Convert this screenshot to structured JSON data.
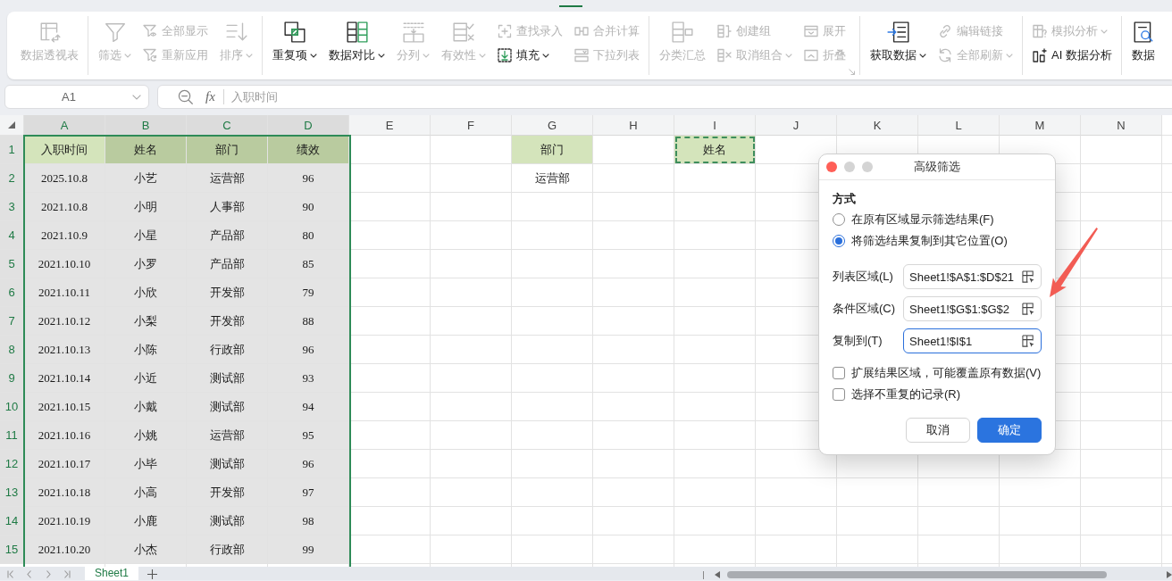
{
  "ribbon": {
    "groups": [
      {
        "launcher": false,
        "columns": [
          {
            "kind": "large",
            "items": [
              {
                "label": "数据透视表",
                "disabled": true,
                "dropdown": false
              }
            ]
          }
        ]
      },
      {
        "launcher": false,
        "columns": [
          {
            "kind": "large",
            "items": [
              {
                "label": "筛选",
                "disabled": true,
                "dropdown": true
              }
            ]
          },
          {
            "kind": "small",
            "items": [
              {
                "label": "全部显示",
                "disabled": true,
                "dropdown": false
              },
              {
                "label": "重新应用",
                "disabled": true,
                "dropdown": false
              }
            ]
          },
          {
            "kind": "large",
            "items": [
              {
                "label": "排序",
                "disabled": true,
                "dropdown": true
              }
            ]
          }
        ]
      },
      {
        "launcher": false,
        "columns": [
          {
            "kind": "large",
            "items": [
              {
                "label": "重复项",
                "disabled": false,
                "dropdown": true
              }
            ]
          },
          {
            "kind": "large",
            "items": [
              {
                "label": "数据对比",
                "disabled": false,
                "dropdown": true
              }
            ]
          },
          {
            "kind": "large",
            "items": [
              {
                "label": "分列",
                "disabled": true,
                "dropdown": true
              }
            ]
          },
          {
            "kind": "large",
            "items": [
              {
                "label": "有效性",
                "disabled": true,
                "dropdown": true
              }
            ]
          },
          {
            "kind": "small",
            "items": [
              {
                "label": "查找录入",
                "disabled": true,
                "dropdown": false
              },
              {
                "label": "填充",
                "disabled": false,
                "dropdown": true
              }
            ]
          },
          {
            "kind": "small",
            "items": [
              {
                "label": "合并计算",
                "disabled": true,
                "dropdown": false
              },
              {
                "label": "下拉列表",
                "disabled": true,
                "dropdown": false
              }
            ]
          }
        ]
      },
      {
        "launcher": true,
        "columns": [
          {
            "kind": "large",
            "items": [
              {
                "label": "分类汇总",
                "disabled": true,
                "dropdown": false
              }
            ]
          },
          {
            "kind": "small",
            "items": [
              {
                "label": "创建组",
                "disabled": true,
                "dropdown": false
              },
              {
                "label": "取消组合",
                "disabled": true,
                "dropdown": true
              }
            ]
          },
          {
            "kind": "small",
            "items": [
              {
                "label": "展开",
                "disabled": true,
                "dropdown": false
              },
              {
                "label": "折叠",
                "disabled": true,
                "dropdown": false
              }
            ]
          }
        ]
      },
      {
        "launcher": false,
        "columns": [
          {
            "kind": "large",
            "items": [
              {
                "label": "获取数据",
                "disabled": false,
                "dropdown": true
              }
            ]
          },
          {
            "kind": "small",
            "items": [
              {
                "label": "编辑链接",
                "disabled": true,
                "dropdown": false
              },
              {
                "label": "全部刷新",
                "disabled": true,
                "dropdown": true
              }
            ]
          }
        ]
      },
      {
        "launcher": false,
        "columns": [
          {
            "kind": "small",
            "items": [
              {
                "label": "模拟分析",
                "disabled": true,
                "dropdown": true
              },
              {
                "label": "AI 数据分析",
                "disabled": false,
                "dropdown": false
              }
            ]
          }
        ]
      },
      {
        "launcher": false,
        "columns": [
          {
            "kind": "large",
            "items": [
              {
                "label": "数据",
                "disabled": false,
                "dropdown": false
              }
            ]
          }
        ]
      }
    ]
  },
  "formula_bar": {
    "name_box": "A1",
    "function_label": "fx",
    "formula": "入职时间"
  },
  "grid": {
    "columns": [
      {
        "label": "A",
        "selected": true
      },
      {
        "label": "B",
        "selected": true
      },
      {
        "label": "C",
        "selected": true
      },
      {
        "label": "D",
        "selected": true
      },
      {
        "label": "E",
        "selected": false
      },
      {
        "label": "F",
        "selected": false
      },
      {
        "label": "G",
        "selected": false
      },
      {
        "label": "H",
        "selected": false
      },
      {
        "label": "I",
        "selected": false
      },
      {
        "label": "J",
        "selected": false
      },
      {
        "label": "K",
        "selected": false
      },
      {
        "label": "L",
        "selected": false
      },
      {
        "label": "M",
        "selected": false
      },
      {
        "label": "N",
        "selected": false
      }
    ],
    "rows": [
      {
        "label": "1",
        "selected": true,
        "cells": [
          {
            "text": "入职时间",
            "highlighted": true,
            "active": true
          },
          {
            "text": "姓名",
            "highlighted": true
          },
          {
            "text": "部门",
            "highlighted": true
          },
          {
            "text": "绩效",
            "highlighted": true
          },
          {
            "highlighted": false
          },
          {
            "highlighted": false
          },
          {
            "text": "部门",
            "highlighted": true
          },
          {
            "highlighted": false
          },
          {
            "text": "姓名",
            "highlighted": true,
            "marquee": true
          }
        ]
      },
      {
        "label": "2",
        "selected": true,
        "cells": [
          {
            "text": "2025.10.8",
            "highlighted": false
          },
          {
            "text": "小艺",
            "highlighted": false
          },
          {
            "text": "运营部",
            "highlighted": false
          },
          {
            "text": "96",
            "highlighted": false
          },
          {
            "highlighted": false
          },
          {
            "highlighted": false
          },
          {
            "text": "运营部",
            "highlighted": false
          }
        ]
      },
      {
        "label": "3",
        "selected": true,
        "cells": [
          {
            "text": "2021.10.8",
            "highlighted": false
          },
          {
            "text": "小明",
            "highlighted": false
          },
          {
            "text": "人事部",
            "highlighted": false
          },
          {
            "text": "90",
            "highlighted": false
          }
        ]
      },
      {
        "label": "4",
        "selected": true,
        "cells": [
          {
            "text": "2021.10.9",
            "highlighted": false
          },
          {
            "text": "小星",
            "highlighted": false
          },
          {
            "text": "产品部",
            "highlighted": false
          },
          {
            "text": "80",
            "highlighted": false
          }
        ]
      },
      {
        "label": "5",
        "selected": true,
        "cells": [
          {
            "text": "2021.10.10",
            "highlighted": false
          },
          {
            "text": "小罗",
            "highlighted": false
          },
          {
            "text": "产品部",
            "highlighted": false
          },
          {
            "text": "85",
            "highlighted": false
          }
        ]
      },
      {
        "label": "6",
        "selected": true,
        "cells": [
          {
            "text": "2021.10.11",
            "highlighted": false
          },
          {
            "text": "小欣",
            "highlighted": false
          },
          {
            "text": "开发部",
            "highlighted": false
          },
          {
            "text": "79",
            "highlighted": false
          }
        ]
      },
      {
        "label": "7",
        "selected": true,
        "cells": [
          {
            "text": "2021.10.12",
            "highlighted": false
          },
          {
            "text": "小梨",
            "highlighted": false
          },
          {
            "text": "开发部",
            "highlighted": false
          },
          {
            "text": "88",
            "highlighted": false
          }
        ]
      },
      {
        "label": "8",
        "selected": true,
        "cells": [
          {
            "text": "2021.10.13",
            "highlighted": false
          },
          {
            "text": "小陈",
            "highlighted": false
          },
          {
            "text": "行政部",
            "highlighted": false
          },
          {
            "text": "96",
            "highlighted": false
          }
        ]
      },
      {
        "label": "9",
        "selected": true,
        "cells": [
          {
            "text": "2021.10.14",
            "highlighted": false
          },
          {
            "text": "小近",
            "highlighted": false
          },
          {
            "text": "测试部",
            "highlighted": false
          },
          {
            "text": "93",
            "highlighted": false
          }
        ]
      },
      {
        "label": "10",
        "selected": true,
        "cells": [
          {
            "text": "2021.10.15",
            "highlighted": false
          },
          {
            "text": "小戴",
            "highlighted": false
          },
          {
            "text": "测试部",
            "highlighted": false
          },
          {
            "text": "94",
            "highlighted": false
          }
        ]
      },
      {
        "label": "11",
        "selected": true,
        "cells": [
          {
            "text": "2021.10.16",
            "highlighted": false
          },
          {
            "text": "小姚",
            "highlighted": false
          },
          {
            "text": "运营部",
            "highlighted": false
          },
          {
            "text": "95",
            "highlighted": false
          }
        ]
      },
      {
        "label": "12",
        "selected": true,
        "cells": [
          {
            "text": "2021.10.17",
            "highlighted": false
          },
          {
            "text": "小毕",
            "highlighted": false
          },
          {
            "text": "测试部",
            "highlighted": false
          },
          {
            "text": "96",
            "highlighted": false
          }
        ]
      },
      {
        "label": "13",
        "selected": true,
        "cells": [
          {
            "text": "2021.10.18",
            "highlighted": false
          },
          {
            "text": "小高",
            "highlighted": false
          },
          {
            "text": "开发部",
            "highlighted": false
          },
          {
            "text": "97",
            "highlighted": false
          }
        ]
      },
      {
        "label": "14",
        "selected": true,
        "cells": [
          {
            "text": "2021.10.19",
            "highlighted": false
          },
          {
            "text": "小鹿",
            "highlighted": false
          },
          {
            "text": "测试部",
            "highlighted": false
          },
          {
            "text": "98",
            "highlighted": false
          }
        ]
      },
      {
        "label": "15",
        "selected": true,
        "cells": [
          {
            "text": "2021.10.20",
            "highlighted": false
          },
          {
            "text": "小杰",
            "highlighted": false
          },
          {
            "text": "行政部",
            "highlighted": false
          },
          {
            "text": "99",
            "highlighted": false
          }
        ]
      }
    ]
  },
  "dialog": {
    "title": "高级筛选",
    "section": "方式",
    "options": [
      {
        "label": "在原有区域显示筛选结果(F)",
        "selected": false
      },
      {
        "label": "将筛选结果复制到其它位置(O)",
        "selected": true
      }
    ],
    "fields": [
      {
        "label": "列表区域(L)",
        "value": "Sheet1!$A$1:$D$21",
        "focused": false
      },
      {
        "label": "条件区域(C)",
        "value": "Sheet1!$G$1:$G$2",
        "focused": false
      },
      {
        "label": "复制到(T)",
        "value": "Sheet1!$I$1",
        "focused": true
      }
    ],
    "checkboxes": [
      {
        "label": "扩展结果区域，可能覆盖原有数据(V)",
        "checked": false
      },
      {
        "label": "选择不重复的记录(R)",
        "checked": false
      }
    ],
    "buttons": [
      {
        "label": "取消",
        "kind": "secondary"
      },
      {
        "label": "确定",
        "kind": "primary"
      }
    ]
  },
  "sheet_bar": {
    "tabs": [
      {
        "label": "Sheet1",
        "selected": true
      }
    ]
  }
}
